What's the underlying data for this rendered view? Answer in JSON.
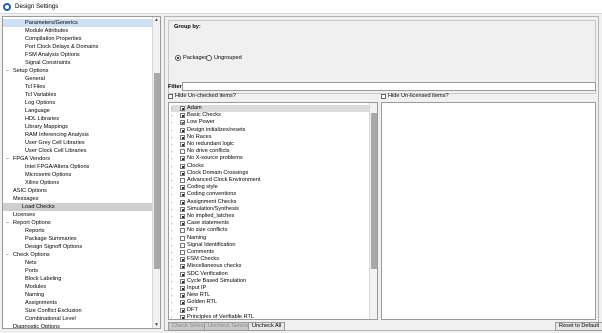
{
  "window": {
    "title": "Design Settings"
  },
  "tree": [
    {
      "label": "Parameters/Generics",
      "level": 1,
      "selected_blue": true
    },
    {
      "label": "Module Attributes",
      "level": 1
    },
    {
      "label": "Compilation Properties",
      "level": 1
    },
    {
      "label": "Port Clock Delays & Domains",
      "level": 1
    },
    {
      "label": "FSM Analysis Options",
      "level": 1
    },
    {
      "label": "Signal Constraints",
      "level": 1
    },
    {
      "label": "Setup Options",
      "level": 0,
      "expanded": true
    },
    {
      "label": "General",
      "level": 1
    },
    {
      "label": "Tcl Files",
      "level": 1
    },
    {
      "label": "Tcl Variables",
      "level": 1
    },
    {
      "label": "Log Options",
      "level": 1
    },
    {
      "label": "Language",
      "level": 1
    },
    {
      "label": "HDL Libraries",
      "level": 1
    },
    {
      "label": "Library Mappings",
      "level": 1
    },
    {
      "label": "RAM Inferencing Analysis",
      "level": 1
    },
    {
      "label": "User Grey Cell Libraries",
      "level": 1
    },
    {
      "label": "User Clock Cell Libraries",
      "level": 1
    },
    {
      "label": "FPGA Vendors",
      "level": 0,
      "expanded": true
    },
    {
      "label": "Intel FPGA/Altera Options",
      "level": 1
    },
    {
      "label": "Microsemi Options",
      "level": 1
    },
    {
      "label": "Xilinx Options",
      "level": 1
    },
    {
      "label": "ASIC Options",
      "level": 0
    },
    {
      "label": "Messages",
      "level": 0
    },
    {
      "label": "Load Checks",
      "level": 0,
      "selected": true
    },
    {
      "label": "Licenses",
      "level": 0
    },
    {
      "label": "Report Options",
      "level": 0,
      "expanded": true
    },
    {
      "label": "Reports",
      "level": 1
    },
    {
      "label": "Package Summaries",
      "level": 1
    },
    {
      "label": "Design Signoff Options",
      "level": 1
    },
    {
      "label": "Check Options",
      "level": 0,
      "expanded": true
    },
    {
      "label": "Nets",
      "level": 1
    },
    {
      "label": "Ports",
      "level": 1
    },
    {
      "label": "Block Labeling",
      "level": 1
    },
    {
      "label": "Modules",
      "level": 1
    },
    {
      "label": "Naming",
      "level": 1
    },
    {
      "label": "Assignments",
      "level": 1
    },
    {
      "label": "Size Conflict Exclusion",
      "level": 1
    },
    {
      "label": "Combinational Level",
      "level": 1
    },
    {
      "label": "Diagnostic Options",
      "level": 0
    }
  ],
  "groupby": {
    "title": "Group by:",
    "packages": "Packages",
    "ungrouped": "Ungrouped"
  },
  "filter": {
    "label": "Filter:",
    "value": ""
  },
  "hide_unchecked": "Hide Un-checked items?",
  "hide_unlicensed": "Hide Un-licensed items?",
  "checks": [
    {
      "label": "Adam",
      "state": "partial",
      "sel": true
    },
    {
      "label": "Basic Checks",
      "state": "partial"
    },
    {
      "label": "Low Power",
      "state": "checked"
    },
    {
      "label": "Design initializes/resets",
      "state": "partial"
    },
    {
      "label": "No Races",
      "state": "partial"
    },
    {
      "label": "No redundant logic",
      "state": "partial"
    },
    {
      "label": "No drive conflicts",
      "state": "empty"
    },
    {
      "label": "No X-source problems",
      "state": "partial"
    },
    {
      "label": "Clocks",
      "state": "partial"
    },
    {
      "label": "Clock Domain Crossings",
      "state": "partial"
    },
    {
      "label": "Advanced Clock Environment",
      "state": "empty"
    },
    {
      "label": "Coding style",
      "state": "partial"
    },
    {
      "label": "Coding conventions",
      "state": "partial"
    },
    {
      "label": "Assignment Checks",
      "state": "partial"
    },
    {
      "label": "Simulation/Synthesis",
      "state": "partial"
    },
    {
      "label": "No implied_latches",
      "state": "partial"
    },
    {
      "label": "Case statements",
      "state": "partial"
    },
    {
      "label": "No size conflicts",
      "state": "empty"
    },
    {
      "label": "Naming",
      "state": "empty"
    },
    {
      "label": "Signal Identification",
      "state": "empty"
    },
    {
      "label": "Comments",
      "state": "empty"
    },
    {
      "label": "FSM Checks",
      "state": "partial"
    },
    {
      "label": "Miscellaneous checks",
      "state": "partial"
    },
    {
      "label": "SDC Verification",
      "state": "partial"
    },
    {
      "label": "Cycle Based Simulation",
      "state": "partial"
    },
    {
      "label": "Input IP",
      "state": "partial"
    },
    {
      "label": "New RTL",
      "state": "partial"
    },
    {
      "label": "Golden RTL",
      "state": "partial"
    },
    {
      "label": "DFT",
      "state": "partial"
    },
    {
      "label": "Principles of Verifiable RTL",
      "state": "partial"
    }
  ],
  "buttons": {
    "check_selected": "Check Selected",
    "uncheck_selected": "Uncheck Selected",
    "uncheck_all": "Uncheck All",
    "reset_default": "Reset to Default"
  }
}
